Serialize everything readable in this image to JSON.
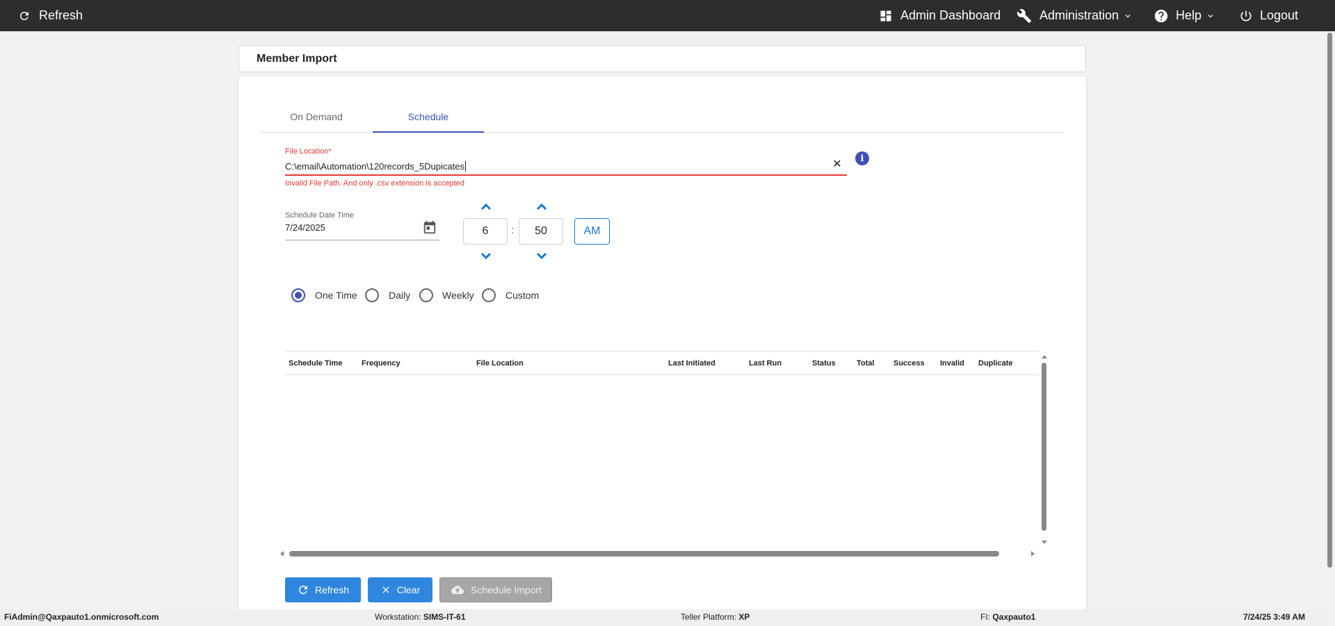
{
  "topbar": {
    "refresh_label": "Refresh",
    "dashboard_label": "Admin Dashboard",
    "administration_label": "Administration",
    "help_label": "Help",
    "logout_label": "Logout"
  },
  "page": {
    "title": "Member Import"
  },
  "tabs": [
    {
      "label": "On Demand",
      "active": false
    },
    {
      "label": "Schedule",
      "active": true
    }
  ],
  "file_location": {
    "label": "File Location*",
    "value": "C:\\email\\Automation\\120records_5Dupicates",
    "error": "Invalid File Path. And only .csv extension is accepted",
    "clear_icon": "close-icon",
    "info_icon": "info-icon"
  },
  "schedule_datetime": {
    "label": "Schedule Date Time",
    "date_value": "7/24/2025",
    "hour": "6",
    "minute": "50",
    "separator": ":",
    "period": "AM"
  },
  "frequency": {
    "options": [
      "One Time",
      "Daily",
      "Weekly",
      "Custom"
    ],
    "selected": "One Time"
  },
  "table": {
    "columns": [
      "Schedule Time",
      "Frequency",
      "File Location",
      "Last Initiated",
      "Last Run",
      "Status",
      "Total",
      "Success",
      "Invalid",
      "Duplicate"
    ],
    "rows": []
  },
  "buttons": {
    "refresh": "Refresh",
    "clear": "Clear",
    "schedule_import": "Schedule Import"
  },
  "statusbar": {
    "user": "FiAdmin@Qaxpauto1.onmicrosoft.com",
    "workstation_label": "Workstation:",
    "workstation_value": "SIMS-IT-61",
    "teller_label": "Teller Platform:",
    "teller_value": "XP",
    "fi_label": "FI:",
    "fi_value": "Qaxpauto1",
    "datetime": "7/24/25 3:49 AM"
  },
  "colors": {
    "topbar": "#2d2d2d",
    "accent": "#3f51b5",
    "button_blue": "#2e86de",
    "error": "#e53935"
  }
}
